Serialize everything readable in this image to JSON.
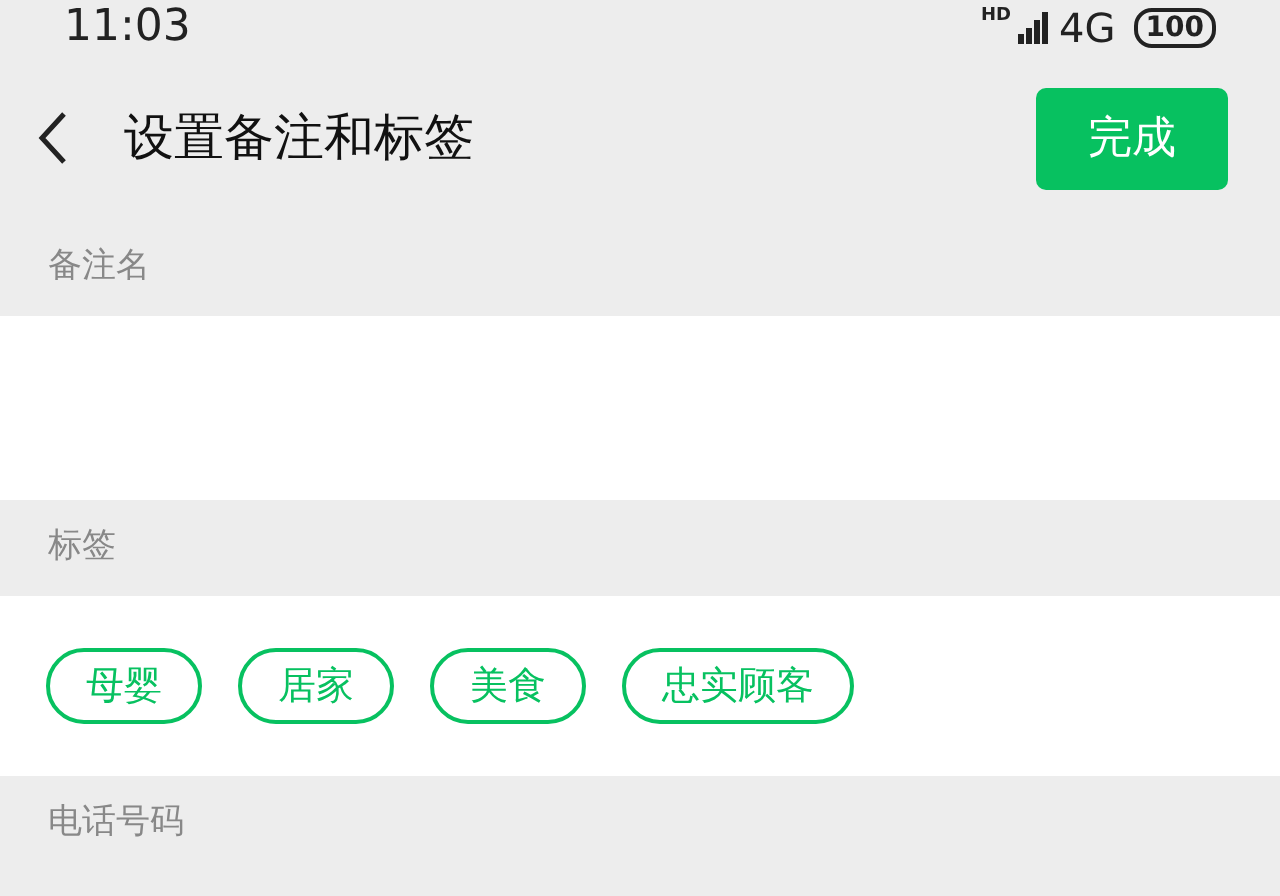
{
  "status_bar": {
    "time": "11:03",
    "hd": "HD",
    "network": "4G",
    "battery": "100"
  },
  "header": {
    "title": "设置备注和标签",
    "done_button": "完成"
  },
  "remark": {
    "label": "备注名"
  },
  "tags": {
    "label": "标签",
    "items": [
      "母婴",
      "居家",
      "美食",
      "忠实顾客"
    ]
  },
  "phone": {
    "label": "电话号码"
  }
}
